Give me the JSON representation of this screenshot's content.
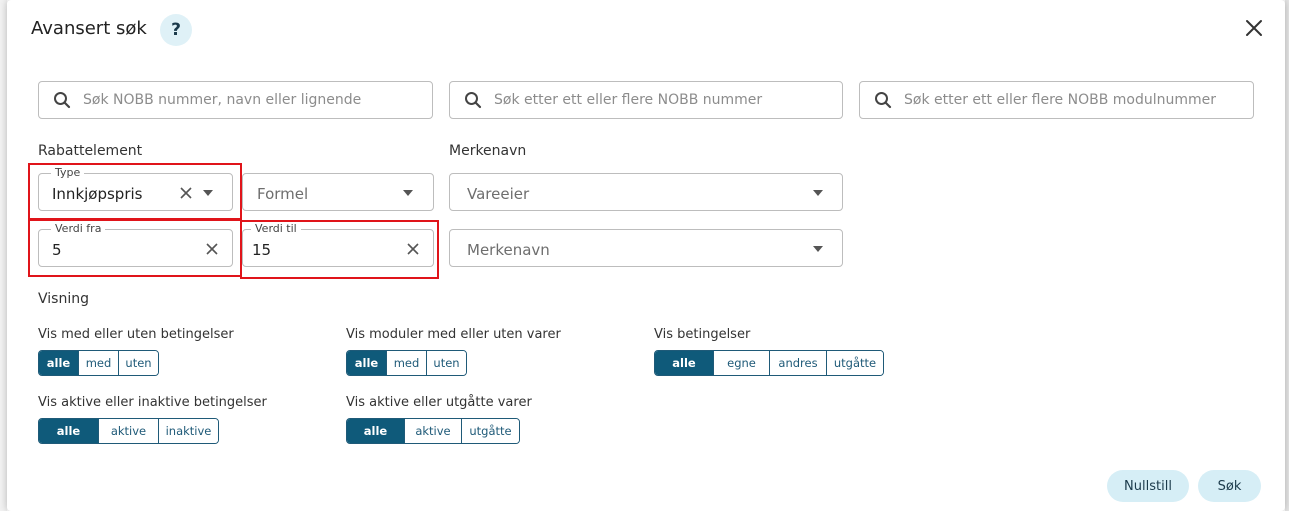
{
  "dialog": {
    "title": "Avansert søk",
    "help_label": "?"
  },
  "search": {
    "general_placeholder": "Søk NOBB nummer, navn eller lignende",
    "nobb_placeholder": "Søk etter ett eller flere NOBB nummer",
    "module_placeholder": "Søk etter ett eller flere NOBB modulnummer"
  },
  "rabattelement": {
    "label": "Rabattelement",
    "type_legend": "Type",
    "type_value": "Innkjøpspris",
    "formel_placeholder": "Formel",
    "verdi_fra_legend": "Verdi fra",
    "verdi_fra_value": "5",
    "verdi_til_legend": "Verdi til",
    "verdi_til_value": "15"
  },
  "merkenavn": {
    "label": "Merkenavn",
    "vareeier_placeholder": "Vareeier",
    "merkenavn_placeholder": "Merkenavn"
  },
  "visning": {
    "label": "Visning",
    "groups": [
      {
        "label": "Vis med eller uten betingelser",
        "options": [
          "alle",
          "med",
          "uten"
        ],
        "selected": "alle"
      },
      {
        "label": "Vis moduler med eller uten varer",
        "options": [
          "alle",
          "med",
          "uten"
        ],
        "selected": "alle"
      },
      {
        "label": "Vis betingelser",
        "options": [
          "alle",
          "egne",
          "andres",
          "utgåtte"
        ],
        "selected": "alle"
      },
      {
        "label": "Vis aktive eller inaktive betingelser",
        "options": [
          "alle",
          "aktive",
          "inaktive"
        ],
        "selected": "alle"
      },
      {
        "label": "Vis aktive eller utgåtte varer",
        "options": [
          "alle",
          "aktive",
          "utgåtte"
        ],
        "selected": "alle"
      }
    ]
  },
  "actions": {
    "reset_label": "Nullstill",
    "search_label": "Søk"
  },
  "colors": {
    "accent": "#0f5a7a",
    "button_bg": "#d6eef6",
    "highlight": "#e0141a"
  }
}
